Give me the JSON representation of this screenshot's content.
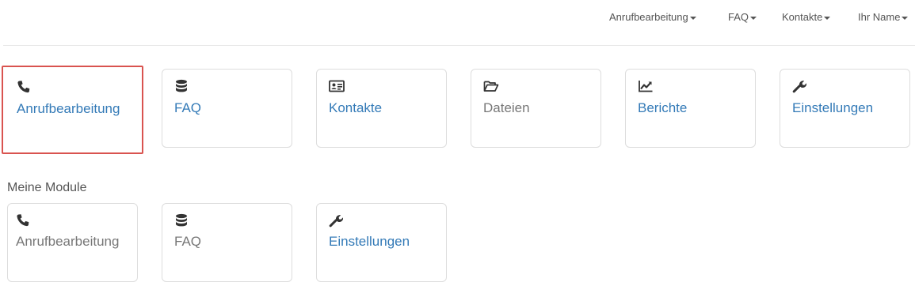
{
  "nav": {
    "items": [
      {
        "label": "Anrufbearbeitung"
      },
      {
        "label": "FAQ"
      },
      {
        "label": "Kontakte"
      },
      {
        "label": "Ihr Name"
      }
    ]
  },
  "tiles": [
    {
      "label": "Anrufbearbeitung",
      "icon": "phone-icon",
      "style": "link",
      "selected": true
    },
    {
      "label": "FAQ",
      "icon": "database-icon",
      "style": "link"
    },
    {
      "label": "Kontakte",
      "icon": "contact-card-icon",
      "style": "link"
    },
    {
      "label": "Dateien",
      "icon": "folder-open-icon",
      "style": "muted"
    },
    {
      "label": "Berichte",
      "icon": "line-chart-icon",
      "style": "link"
    },
    {
      "label": "Einstellungen",
      "icon": "wrench-icon",
      "style": "link"
    }
  ],
  "modules": {
    "title": "Meine Module",
    "tiles": [
      {
        "label": "Anrufbearbeitung",
        "icon": "phone-icon",
        "style": "muted"
      },
      {
        "label": "FAQ",
        "icon": "database-icon",
        "style": "muted"
      },
      {
        "label": "Einstellungen",
        "icon": "wrench-icon",
        "style": "link"
      }
    ]
  },
  "colors": {
    "link": "#337ab7",
    "muted": "#777777",
    "selected_border": "#d9534f"
  }
}
